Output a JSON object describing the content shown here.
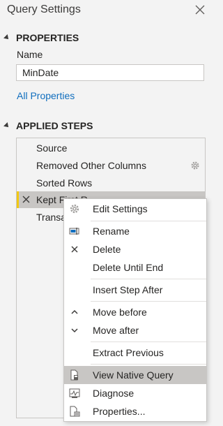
{
  "panel": {
    "title": "Query Settings"
  },
  "properties": {
    "heading": "PROPERTIES",
    "name_label": "Name",
    "name_value": "MinDate",
    "all_properties_link": "All Properties"
  },
  "applied_steps": {
    "heading": "APPLIED STEPS",
    "steps": [
      {
        "label": "Source"
      },
      {
        "label": "Removed Other Columns"
      },
      {
        "label": "Sorted Rows"
      },
      {
        "label": "Kept First R"
      },
      {
        "label": "Transa"
      }
    ]
  },
  "context_menu": {
    "items": [
      {
        "label": "Edit Settings",
        "icon": "gear-icon"
      },
      {
        "label": "Rename",
        "icon": "rename-icon"
      },
      {
        "label": "Delete",
        "icon": "x-icon"
      },
      {
        "label": "Delete Until End",
        "icon": ""
      },
      {
        "label": "Insert Step After",
        "icon": ""
      },
      {
        "label": "Move before",
        "icon": "chevron-up-icon"
      },
      {
        "label": "Move after",
        "icon": "chevron-down-icon"
      },
      {
        "label": "Extract Previous",
        "icon": ""
      },
      {
        "label": "View Native Query",
        "icon": "native-query-icon"
      },
      {
        "label": "Diagnose",
        "icon": "diagnose-icon"
      },
      {
        "label": "Properties...",
        "icon": "properties-icon"
      }
    ]
  },
  "colors": {
    "accent": "#f2c811",
    "link": "#106ebe",
    "selected_bg": "#c8c6c4"
  }
}
